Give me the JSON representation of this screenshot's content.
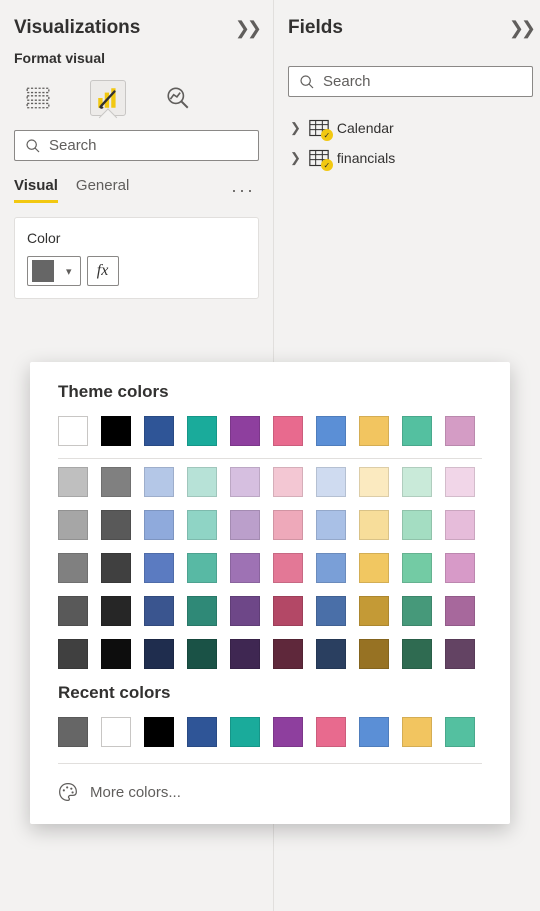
{
  "visualizations": {
    "title": "Visualizations",
    "subtitle": "Format visual",
    "search_placeholder": "Search",
    "tabs": {
      "visual": "Visual",
      "general": "General"
    },
    "card": {
      "label": "Color",
      "fx": "fx",
      "current_color": "#666666"
    }
  },
  "color_picker": {
    "theme_title": "Theme colors",
    "recent_title": "Recent colors",
    "more": "More colors...",
    "theme_header": [
      "#ffffff",
      "#000000",
      "#2f5597",
      "#1aab9b",
      "#8e3f9e",
      "#e86a8e",
      "#5b8fd6",
      "#f2c560",
      "#54c0a0",
      "#d49cc5"
    ],
    "theme_shades": [
      [
        "#bfbfbf",
        "#808080",
        "#b4c7e7",
        "#b7e2d7",
        "#d6bfe0",
        "#f3c7d3",
        "#cfdbf0",
        "#fbeac0",
        "#c9ead9",
        "#f1d6e8"
      ],
      [
        "#a6a6a6",
        "#595959",
        "#8faadc",
        "#8fd4c5",
        "#bb9fcb",
        "#eea9ba",
        "#a9c0e6",
        "#f7dd9a",
        "#a4ddc2",
        "#e6bcda"
      ],
      [
        "#808080",
        "#404040",
        "#5b7bc1",
        "#58b9a4",
        "#9e72b4",
        "#e37896",
        "#7a9fd7",
        "#f1c761",
        "#73cba4",
        "#d79ac8"
      ],
      [
        "#595959",
        "#262626",
        "#3a558f",
        "#2f8977",
        "#6e4788",
        "#b34866",
        "#4a6fa8",
        "#c49a36",
        "#46997a",
        "#a7689c"
      ],
      [
        "#404040",
        "#0d0d0d",
        "#1f2d4e",
        "#1a5246",
        "#3f2752",
        "#5f283b",
        "#2a3f60",
        "#977223",
        "#2f6b51",
        "#634363"
      ]
    ],
    "recent": [
      "#666666",
      "#ffffff",
      "#000000",
      "#2f5597",
      "#1aab9b",
      "#8e3f9e",
      "#e86a8e",
      "#5b8fd6",
      "#f2c560",
      "#54c0a0"
    ]
  },
  "fields": {
    "title": "Fields",
    "search_placeholder": "Search",
    "tables": [
      {
        "name": "Calendar"
      },
      {
        "name": "financials"
      }
    ]
  }
}
